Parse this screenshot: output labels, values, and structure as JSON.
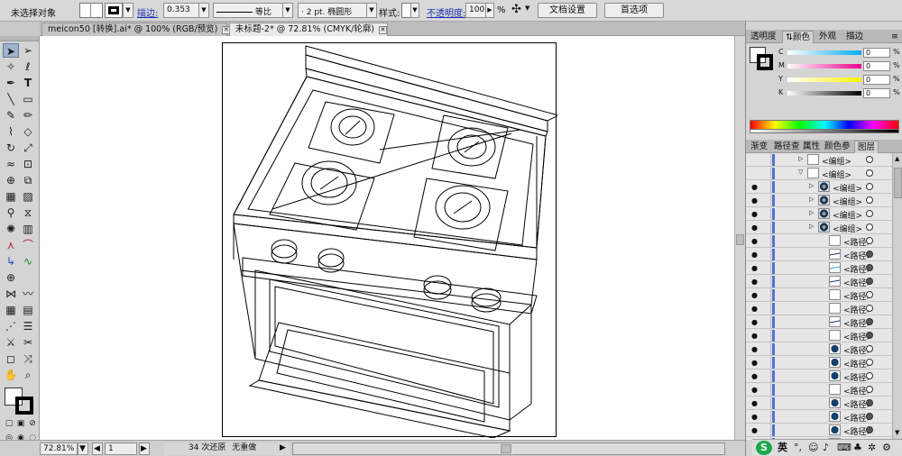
{
  "control_bar": {
    "selection_label": "未选择对象",
    "stroke_label": "描边:",
    "stroke_weight": "0.353",
    "profile_label": "等比",
    "brush_label": "2 pt. 椭圆形",
    "style_label": "样式:",
    "opacity_label": "不透明度:",
    "opacity_value": "100",
    "opacity_unit": "%",
    "doc_setup_button": "文档设置",
    "preferences_button": "首选项"
  },
  "tabs": [
    {
      "label": "meicon50 [转换].ai* @ 100% (RGB/预览)",
      "active": false
    },
    {
      "label": "未标题-2* @ 72.81% (CMYK/轮廓)",
      "active": true
    }
  ],
  "status": {
    "zoom": "72.81%",
    "page": "1",
    "history": "34 次还原",
    "redo": "无重做"
  },
  "color_panel": {
    "tabs": [
      "透明度",
      "颜色",
      "外观",
      "描边"
    ],
    "active_tab": "颜色",
    "channels": [
      {
        "name": "C",
        "value": "0",
        "unit": "%"
      },
      {
        "name": "M",
        "value": "0",
        "unit": "%"
      },
      {
        "name": "Y",
        "value": "0",
        "unit": "%"
      },
      {
        "name": "K",
        "value": "0",
        "unit": "%"
      }
    ]
  },
  "layers_panel": {
    "tabs": [
      "渐变",
      "路径查",
      "属性",
      "颜色参",
      "图层"
    ],
    "active_tab": "图层",
    "rows": [
      {
        "name": "<编组>",
        "indent": 0,
        "expanded": false,
        "thumb": "group",
        "filled": false,
        "eye": false
      },
      {
        "name": "<编组>",
        "indent": 0,
        "expanded": true,
        "thumb": "group",
        "filled": false,
        "eye": false
      },
      {
        "name": "<编组>",
        "indent": 1,
        "expanded": false,
        "thumb": "knob",
        "filled": false,
        "eye": true
      },
      {
        "name": "<编组>",
        "indent": 1,
        "expanded": false,
        "thumb": "knob",
        "filled": false,
        "eye": true
      },
      {
        "name": "<编组>",
        "indent": 1,
        "expanded": false,
        "thumb": "knob",
        "filled": false,
        "eye": true
      },
      {
        "name": "<编组>",
        "indent": 1,
        "expanded": false,
        "thumb": "knob",
        "filled": false,
        "eye": true
      },
      {
        "name": "<路径>",
        "indent": 2,
        "thumb": "blank",
        "filled": false,
        "eye": true
      },
      {
        "name": "<路径>",
        "indent": 2,
        "thumb": "line",
        "filled": true,
        "eye": true
      },
      {
        "name": "<路径>",
        "indent": 2,
        "thumb": "cyan",
        "filled": true,
        "eye": true
      },
      {
        "name": "<路径>",
        "indent": 2,
        "thumb": "line",
        "filled": true,
        "eye": true
      },
      {
        "name": "<路径>",
        "indent": 2,
        "thumb": "blank",
        "filled": false,
        "eye": true
      },
      {
        "name": "<路径>",
        "indent": 2,
        "thumb": "blank",
        "filled": false,
        "eye": true
      },
      {
        "name": "<路径>",
        "indent": 2,
        "thumb": "line",
        "filled": true,
        "eye": true
      },
      {
        "name": "<路径>",
        "indent": 2,
        "thumb": "blank",
        "filled": true,
        "eye": true
      },
      {
        "name": "<路径>",
        "indent": 2,
        "thumb": "dark",
        "filled": false,
        "eye": true
      },
      {
        "name": "<路径>",
        "indent": 2,
        "thumb": "dark",
        "filled": false,
        "eye": true
      },
      {
        "name": "<路径>",
        "indent": 2,
        "thumb": "dark",
        "filled": false,
        "eye": true
      },
      {
        "name": "<路径>",
        "indent": 2,
        "thumb": "blank",
        "filled": false,
        "eye": true
      },
      {
        "name": "<路径>",
        "indent": 2,
        "thumb": "dark",
        "filled": true,
        "eye": true
      },
      {
        "name": "<路径>",
        "indent": 2,
        "thumb": "dark",
        "filled": true,
        "eye": true
      },
      {
        "name": "<路径>",
        "indent": 2,
        "thumb": "dark",
        "filled": true,
        "eye": true
      },
      {
        "name": "<路径>",
        "indent": 2,
        "thumb": "blank",
        "filled": false,
        "eye": true
      }
    ]
  },
  "taskbar": {
    "ime_label": "英"
  },
  "colors": {
    "accent": "#1b2fb3",
    "layer_color": "#4f6fdf",
    "selection": "#9fb3cf"
  }
}
